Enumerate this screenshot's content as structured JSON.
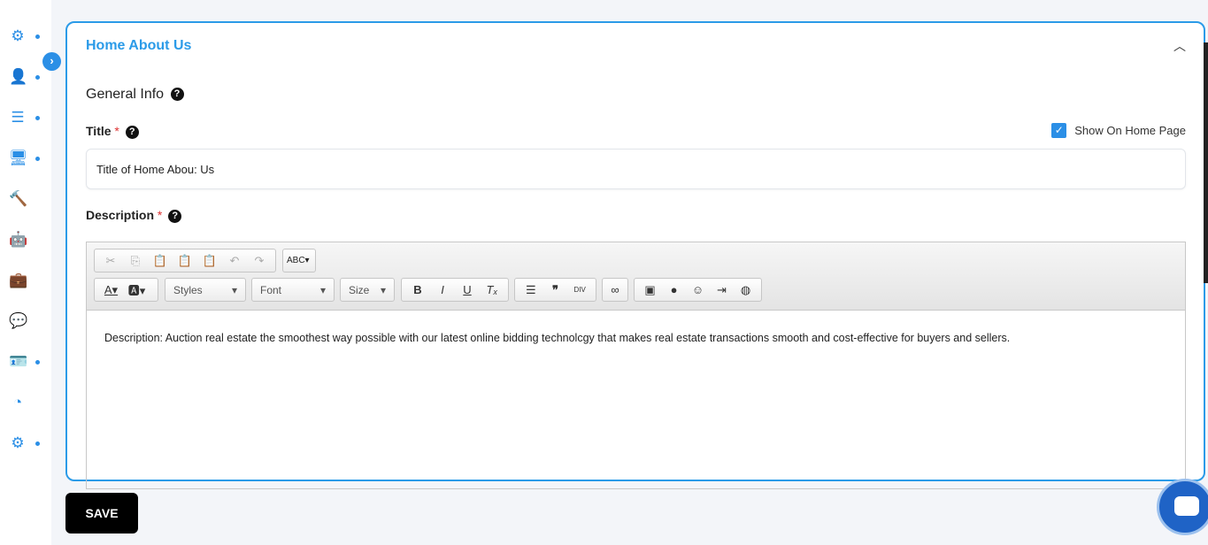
{
  "sidebar": {
    "items": [
      {
        "icon": "gear-icon",
        "glyph": "⚙",
        "dot": true
      },
      {
        "icon": "user-icon",
        "glyph": "👤",
        "dot": true
      },
      {
        "icon": "list-icon",
        "glyph": "☰",
        "dot": true
      },
      {
        "icon": "monitor-icon",
        "glyph": "🖥",
        "dot": true
      },
      {
        "icon": "hammer-icon",
        "glyph": "🔨",
        "dot": false
      },
      {
        "icon": "robot-icon",
        "glyph": "🤖",
        "dot": false
      },
      {
        "icon": "briefcase-icon",
        "glyph": "💼",
        "dot": false
      },
      {
        "icon": "chat-icon",
        "glyph": "💬",
        "dot": false
      },
      {
        "icon": "id-card-icon",
        "glyph": "🪪",
        "dot": true
      },
      {
        "icon": "rss-icon",
        "glyph": "◔",
        "dot": false
      },
      {
        "icon": "gears-icon",
        "glyph": "⚙",
        "dot": true
      }
    ]
  },
  "card": {
    "title": "Home About Us",
    "section": "General Info",
    "title_label": "Title",
    "required": "*",
    "show_on_home": "Show On Home Page",
    "show_on_home_checked": true,
    "title_value": "Title of Home Abou: Us",
    "description_label": "Description"
  },
  "editor": {
    "styles": "Styles",
    "font": "Font",
    "size": "Size",
    "content": "Description: Auction real estate the smoothest way possible with our latest online bidding technolcgy that makes real estate transactions smooth and cost-effective for buyers and sellers."
  },
  "save_label": "SAVE",
  "colors": {
    "accent": "#2b9be8",
    "save": "#000000"
  }
}
